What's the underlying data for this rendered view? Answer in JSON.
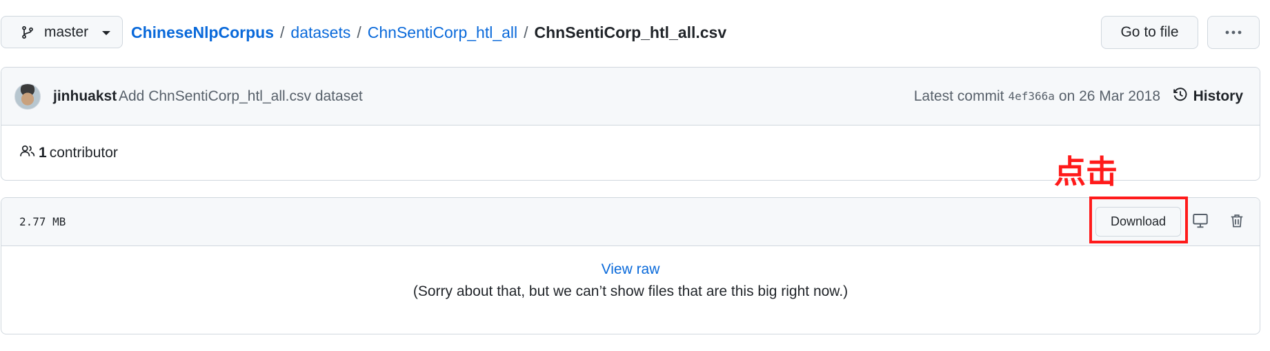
{
  "branch": {
    "name": "master",
    "icon": "git-branch-icon"
  },
  "breadcrumb": {
    "root": "ChineseNlpCorpus",
    "sep1": "/",
    "folder1": "datasets",
    "sep2": "/",
    "folder2": "ChnSentiCorp_htl_all",
    "sep3": "/",
    "file": "ChnSentiCorp_htl_all.csv"
  },
  "toolbar": {
    "goto_label": "Go to file",
    "more_icon": "kebab-horizontal-icon"
  },
  "commit": {
    "author": "jinhuakst",
    "message": "Add ChnSentiCorp_htl_all.csv dataset",
    "latest_label": "Latest commit",
    "sha": "4ef366a",
    "date_text": "on 26 Mar 2018",
    "history_label": "History",
    "history_icon": "history-icon"
  },
  "contributors": {
    "count": "1",
    "label": "contributor",
    "icon": "people-icon"
  },
  "annotation": {
    "text": "点击",
    "color": "#ff1a1a"
  },
  "file": {
    "size": "2.77 MB",
    "download_label": "Download",
    "desktop_icon": "desktop-icon",
    "trash_icon": "trash-icon",
    "view_raw": "View raw",
    "sorry_text": "(Sorry about that, but we can’t show files that are this big right now.)"
  },
  "colors": {
    "link": "#0969da",
    "border": "#d0d7de",
    "header_bg": "#f6f8fa",
    "text": "#1f2328",
    "muted": "#57606a"
  }
}
